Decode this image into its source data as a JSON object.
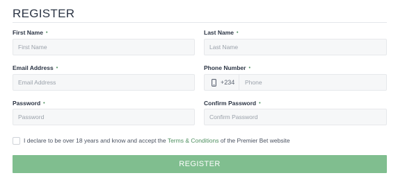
{
  "form": {
    "title": "REGISTER",
    "required_mark": "•",
    "first_name": {
      "label": "First Name",
      "placeholder": "First Name"
    },
    "last_name": {
      "label": "Last Name",
      "placeholder": "Last Name"
    },
    "email": {
      "label": "Email Address",
      "placeholder": "Email Address"
    },
    "phone": {
      "label": "Phone Number",
      "prefix": "+234",
      "placeholder": "Phone",
      "icon": "mobile-phone-icon"
    },
    "password": {
      "label": "Password",
      "placeholder": "Password"
    },
    "confirm_password": {
      "label": "Confirm Password",
      "placeholder": "Confirm Password"
    },
    "declaration": {
      "before": "I declare to be over 18 years and know and accept the ",
      "link": "Terms & Conditions",
      "after": " of the Premier Bet website"
    },
    "submit_label": "REGISTER"
  },
  "colors": {
    "accent": "#4e8f5f",
    "button_bg": "#80be8f",
    "field_bg": "#f6f7f8",
    "text": "#2b3444"
  }
}
